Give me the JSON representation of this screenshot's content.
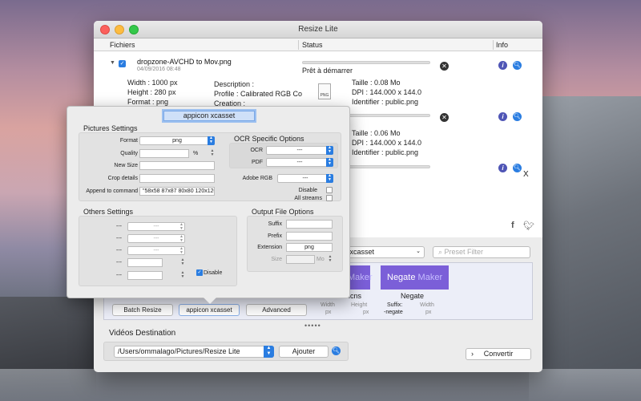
{
  "window": {
    "title": "Resize Lite"
  },
  "table": {
    "headers": {
      "files": "Fichiers",
      "status": "Status",
      "info": "Info"
    }
  },
  "files": [
    {
      "name": "dropzone-AVCHD to Mov.png",
      "date": "04/09/2016 08:48",
      "status": "Prêt à démarrer",
      "width": "Width : 1000 px",
      "height": "Height : 280 px",
      "format": "Format : png",
      "description": "Description :",
      "profile": "Profile : Calibrated RGB Co",
      "creation": "Creation :",
      "size": "Taille : 0.08 Mo",
      "dpi": "DPI : 144.000 x 144.0",
      "identifier": "Identifier : public.png",
      "icon_label": "PNG"
    },
    {
      "size": "Taille : 0.06 Mo",
      "dpi": "DPI : 144.000 x 144.0",
      "identifier": "Identifier : public.png"
    }
  ],
  "close_x": "X",
  "preset": {
    "selected": "n xcasset",
    "search_placeholder": "Preset Filter",
    "makers": [
      {
        "main": "",
        "sub": "Maker",
        "label": "icns"
      },
      {
        "main": "Negate",
        "sub": "Maker",
        "label": "Negate"
      }
    ],
    "width_label": "Width",
    "height_label": "Height",
    "suffix_label": "Suffix:",
    "suffix_value": "-negate",
    "px": "px",
    "tabs": [
      "Batch Resize",
      "appicon xcasset",
      "Advanced"
    ],
    "dots": "•••••"
  },
  "destination": {
    "label": "Vidéos Destination",
    "path": "/Users/ommalago/Pictures/Resize Lite",
    "add_button": "Ajouter",
    "convert_button": "Convertir"
  },
  "popover": {
    "title": "appicon xcasset",
    "pictures_settings": {
      "label": "Pictures Settings",
      "format_label": "Format",
      "format_value": "png",
      "quality_label": "Quality",
      "quality_unit": "%",
      "new_size_label": "New Size",
      "crop_label": "Crop details",
      "append_label": "Append to command",
      "append_value": "\"58x58 87x87 80x80 120x120"
    },
    "ocr": {
      "label": "OCR Specific Options",
      "ocr_label": "OCR",
      "ocr_value": "---",
      "pdf_label": "PDF",
      "pdf_value": "---"
    },
    "adobe": {
      "label": "Adobe RGB",
      "value": "---"
    },
    "disable_label": "Disable",
    "all_streams_label": "All streams",
    "others": {
      "label": "Others Settings",
      "dash": "---",
      "disable_label": "Disable"
    },
    "output": {
      "label": "Output File Options",
      "suffix_label": "Suffix",
      "prefix_label": "Prefix",
      "extension_label": "Extension",
      "extension_value": "png",
      "size_label": "Size",
      "size_unit": "Mo"
    }
  },
  "icons": [
    "close-icon",
    "info-icon",
    "magnifier-icon",
    "facebook-icon",
    "twitter-icon",
    "chevron-right-icon"
  ]
}
